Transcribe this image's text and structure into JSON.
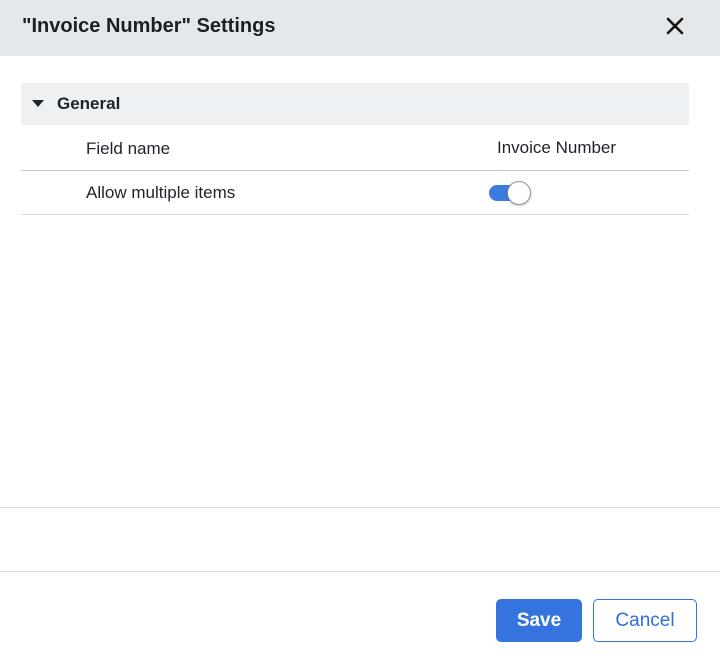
{
  "dialog": {
    "title": "\"Invoice Number\" Settings",
    "close_icon": "close-icon"
  },
  "section": {
    "title": "General",
    "expanded": true,
    "caret_icon": "caret-down-icon"
  },
  "fields": [
    {
      "label": "Field name",
      "value": "Invoice Number"
    },
    {
      "label": "Allow multiple items",
      "toggle_on": true
    }
  ],
  "footer": {
    "save_label": "Save",
    "cancel_label": "Cancel"
  },
  "colors": {
    "header_bg": "#e5e8eb",
    "section_bg": "#eef1f3",
    "accent": "#3574de",
    "toggle_on": "#3b7ae0"
  }
}
